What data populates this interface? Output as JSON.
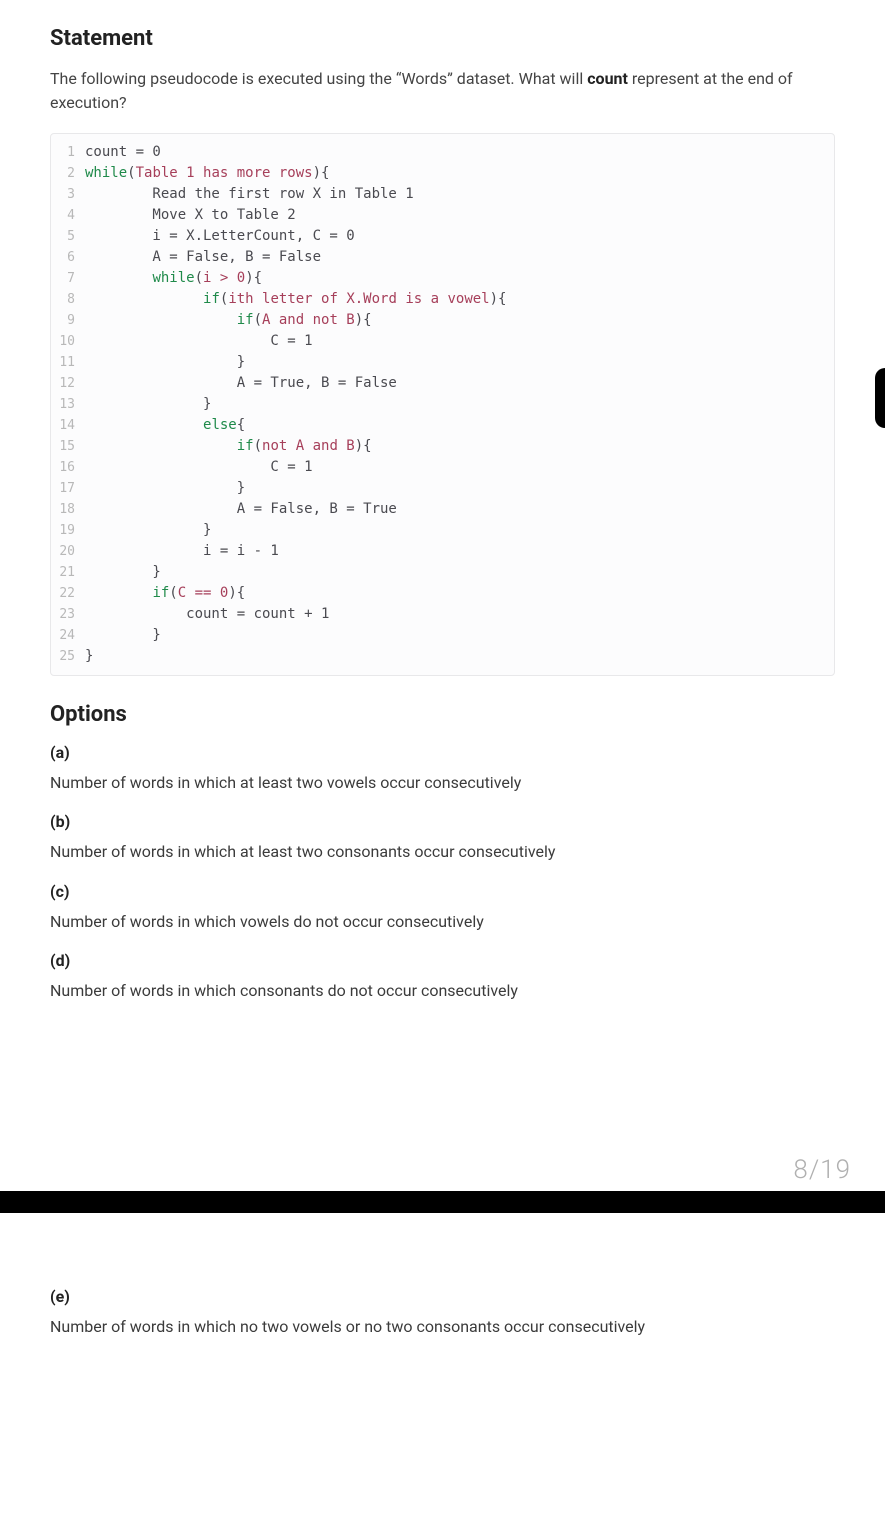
{
  "statement": {
    "heading": "Statement",
    "text_before": "The following pseudocode is executed using the “Words” dataset. What will ",
    "bold_word": "count",
    "text_after": " represent at the end of execution?"
  },
  "code": [
    {
      "n": "1",
      "plain": "count = 0"
    },
    {
      "n": "2",
      "kw": "while",
      "after_kw": "(",
      "hl": "Table 1 has more rows",
      "after_hl": "){"
    },
    {
      "n": "3",
      "plain": "        Read the first row X in Table 1"
    },
    {
      "n": "4",
      "plain": "        Move X to Table 2"
    },
    {
      "n": "5",
      "plain": "        i = X.LetterCount, C = 0"
    },
    {
      "n": "6",
      "plain": "        A = False, B = False"
    },
    {
      "n": "7",
      "indent": "        ",
      "kw": "while",
      "after_kw": "(",
      "hl": "i > 0",
      "after_hl": "){"
    },
    {
      "n": "8",
      "indent": "              ",
      "kw": "if",
      "after_kw": "(",
      "hl": "ith letter of X.Word is a vowel",
      "after_hl": "){"
    },
    {
      "n": "9",
      "indent": "                  ",
      "kw": "if",
      "after_kw": "(",
      "hl": "A and not B",
      "after_hl": "){"
    },
    {
      "n": "10",
      "plain": "                      C = 1"
    },
    {
      "n": "11",
      "plain": "                  }"
    },
    {
      "n": "12",
      "plain": "                  A = True, B = False"
    },
    {
      "n": "13",
      "plain": "              }"
    },
    {
      "n": "14",
      "indent": "              ",
      "kw": "else",
      "after_kw": "{"
    },
    {
      "n": "15",
      "indent": "                  ",
      "kw": "if",
      "after_kw": "(",
      "hl": "not A and B",
      "after_hl": "){"
    },
    {
      "n": "16",
      "plain": "                      C = 1"
    },
    {
      "n": "17",
      "plain": "                  }"
    },
    {
      "n": "18",
      "plain": "                  A = False, B = True"
    },
    {
      "n": "19",
      "plain": "              }"
    },
    {
      "n": "20",
      "plain": "              i = i - 1"
    },
    {
      "n": "21",
      "plain": "        }"
    },
    {
      "n": "22",
      "indent": "        ",
      "kw": "if",
      "after_kw": "(",
      "hl": "C == 0",
      "after_hl": "){"
    },
    {
      "n": "23",
      "plain": "            count = count + 1"
    },
    {
      "n": "24",
      "plain": "        }"
    },
    {
      "n": "25",
      "plain": "}"
    }
  ],
  "options": {
    "heading": "Options",
    "items": [
      {
        "label": "(a)",
        "text": "Number of words in which at least two vowels occur consecutively"
      },
      {
        "label": "(b)",
        "text": "Number of words in which at least two consonants occur consecutively"
      },
      {
        "label": "(c)",
        "text": "Number of words in which vowels do not occur consecutively"
      },
      {
        "label": "(d)",
        "text": "Number of words in which consonants do not occur consecutively"
      }
    ]
  },
  "page_number": "8/19",
  "options_continued": [
    {
      "label": "(e)",
      "text": "Number of words in which no two vowels or no two consonants occur consecutively"
    }
  ]
}
